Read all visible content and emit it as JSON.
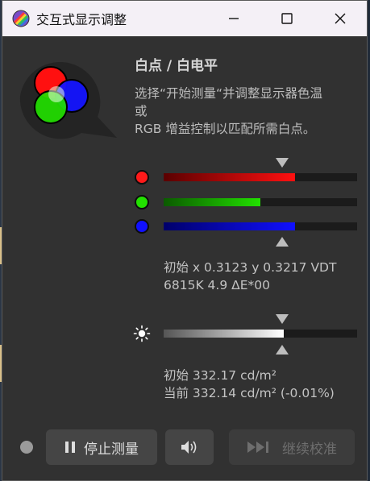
{
  "window": {
    "title": "交互式显示调整",
    "controls": [
      "minimize",
      "maximize",
      "close"
    ]
  },
  "panel": {
    "heading": "白点 / 白电平",
    "description": "选择“开始测量“并调整显示器色温\n或\nRGB 增益控制以匹配所需白点。"
  },
  "rgb": {
    "red": {
      "level": 0.68,
      "color": "#ff1a1a"
    },
    "green": {
      "level": 0.5,
      "color": "#22e000"
    },
    "blue": {
      "level": 0.68,
      "color": "#1010ff"
    }
  },
  "whitepoint_readout": "初始 x 0.3123 y 0.3217 VDT\n6815K 4.9 ΔE*00",
  "luminance": {
    "level": 0.62,
    "readout": "初始 332.17 cd/m²\n当前 332.14 cd/m² (-0.01%)"
  },
  "footer": {
    "stop_label": "停止测量",
    "continue_label": "继续校准"
  }
}
